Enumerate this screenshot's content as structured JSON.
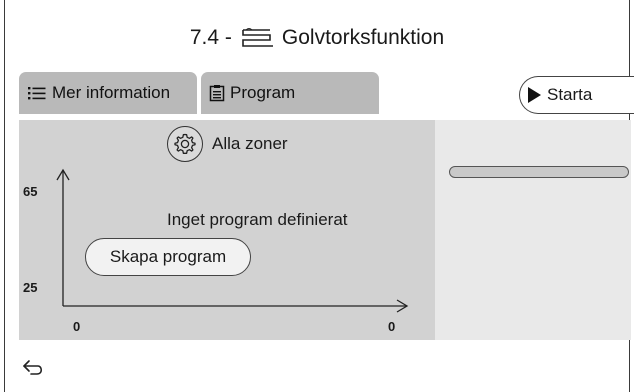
{
  "header": {
    "number": "7.4 -",
    "title": "Golvtorksfunktion",
    "icon": "floor-heating-icon"
  },
  "tabs": [
    {
      "label": "Mer information",
      "icon": "list-icon"
    },
    {
      "label": "Program",
      "icon": "clipboard-icon"
    }
  ],
  "start_button": {
    "label": "Starta",
    "icon": "play-icon"
  },
  "panel": {
    "zone_icon": "gear-icon",
    "zone_label": "Alla zoner",
    "message": "Inget program definierat",
    "create_button": "Skapa program",
    "y_max": "65",
    "y_min": "25",
    "x_min": "0",
    "x_max": "0"
  },
  "side": {
    "progress": 0
  },
  "footer": {
    "back_icon": "back-arrow-icon"
  }
}
